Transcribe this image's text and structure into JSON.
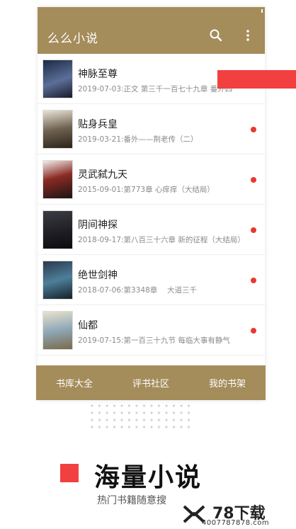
{
  "app": {
    "title": "么么小说"
  },
  "icons": {
    "search": "search-icon",
    "more": "more-vertical-icon"
  },
  "colors": {
    "brand": "#a48c5b",
    "accent_red": "#f23f3f",
    "unread_dot": "#e83830"
  },
  "books": [
    {
      "name": "神脉至尊",
      "meta": "2019-07-03:正文 第三千一百七十九章 番外四",
      "unread": false
    },
    {
      "name": "贴身兵皇",
      "meta": "2019-03-21:番外——荆老传（二）",
      "unread": true
    },
    {
      "name": "灵武弑九天",
      "meta": "2015-09-01:第773章 心痒痒（大结局）",
      "unread": true
    },
    {
      "name": "阴间神探",
      "meta": "2018-09-17:第八百三十六章 新的征程（大结局）",
      "unread": true
    },
    {
      "name": "绝世剑神",
      "meta": "2018-07-06:第3348章　 大道三千",
      "unread": true
    },
    {
      "name": "仙都",
      "meta": "2019-07-15:第一百三十九节 每临大事有静气",
      "unread": true
    }
  ],
  "tabs": [
    {
      "label": "书库大全"
    },
    {
      "label": "评书社区"
    },
    {
      "label": "我的书架"
    }
  ],
  "promo": {
    "headline": "海量小说",
    "subline": "热门书籍随意搜"
  },
  "watermark": {
    "brand": "78下载",
    "site": "4007787878.com"
  }
}
